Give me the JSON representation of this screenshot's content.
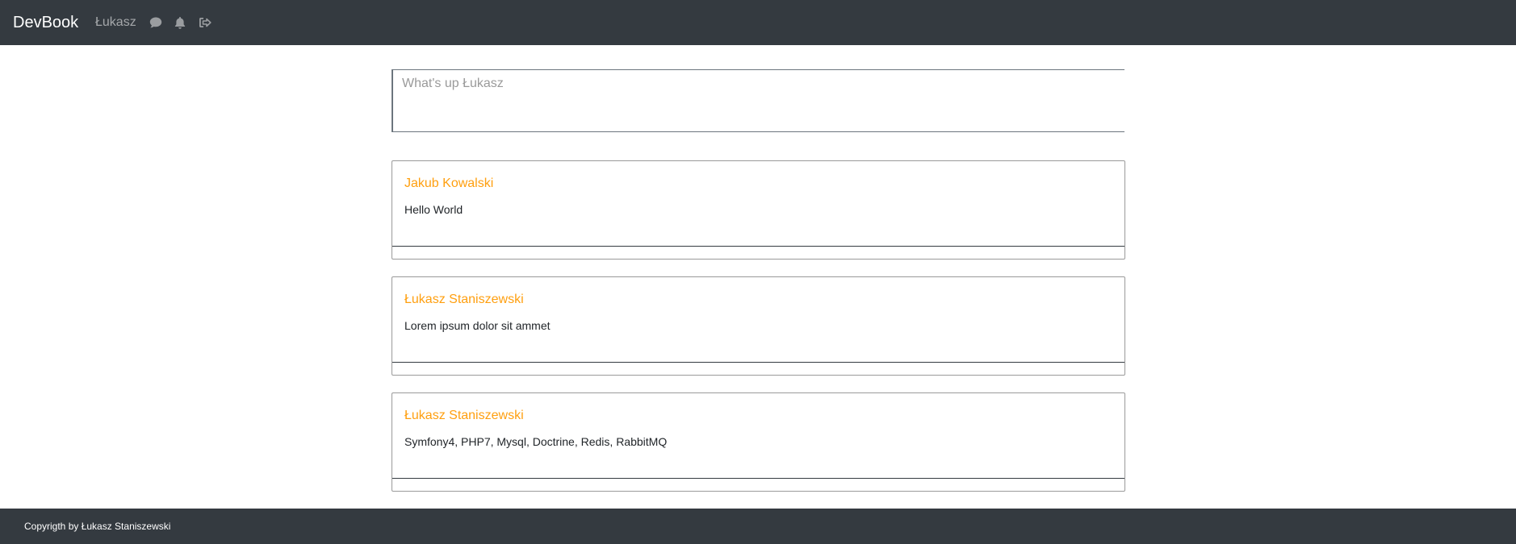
{
  "navbar": {
    "brand": "DevBook",
    "user": "Łukasz",
    "icons": [
      "chat-icon",
      "bell-icon",
      "logout-icon"
    ]
  },
  "composer": {
    "placeholder": "What's up Łukasz",
    "value": ""
  },
  "posts": [
    {
      "author": "Jakub Kowalski",
      "text": "Hello World"
    },
    {
      "author": "Łukasz Staniszewski",
      "text": "Lorem ipsum dolor sit ammet"
    },
    {
      "author": "Łukasz Staniszewski",
      "text": "Symfony4, PHP7, Mysql, Doctrine, Redis, RabbitMQ"
    }
  ],
  "footer": {
    "text": "Copyrigth by Łukasz Staniszewski"
  },
  "colors": {
    "navbar_bg": "#343a40",
    "author_accent": "#ff9f0f"
  }
}
